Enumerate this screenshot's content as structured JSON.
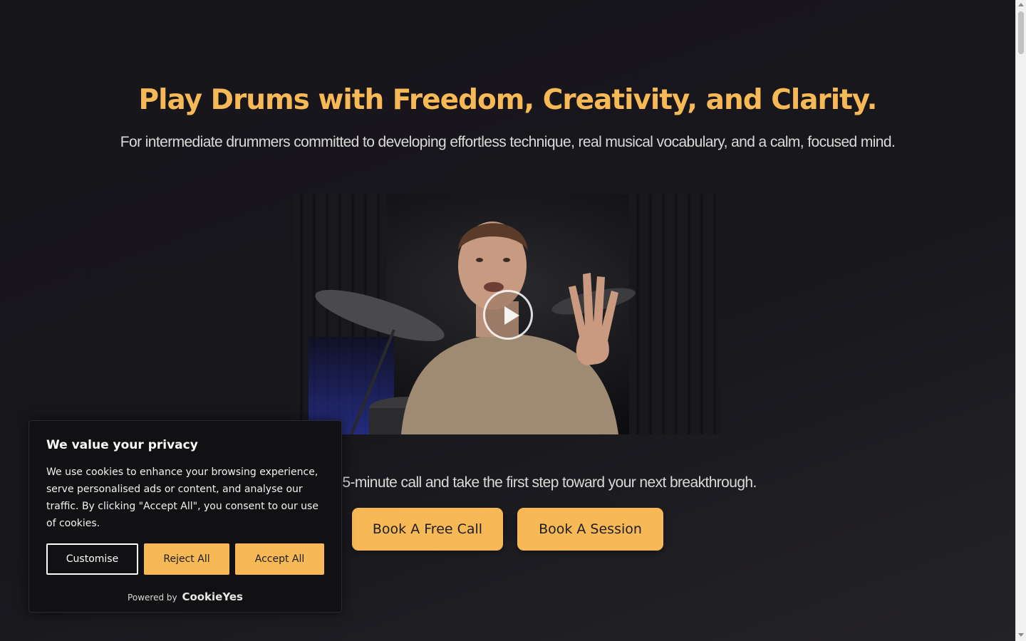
{
  "hero": {
    "title": "Play Drums with Freedom, Creativity, and Clarity.",
    "subtitle": "For intermediate drummers committed to developing effortless technique, real musical vocabulary, and a calm, focused mind."
  },
  "video": {
    "play_icon": "play-icon"
  },
  "cta": {
    "text": "Book a free 15-minute call and take the first step toward your next breakthrough.",
    "free_call_label": "Book A Free Call",
    "session_label": "Book A Session"
  },
  "cookie_banner": {
    "title": "We value your privacy",
    "body": "We use cookies to enhance your browsing experience, serve personalised ads or content, and analyse our traffic. By clicking \"Accept All\", you consent to our use of cookies.",
    "customise_label": "Customise",
    "reject_label": "Reject All",
    "accept_label": "Accept All",
    "powered_by": "Powered by",
    "brand": "CookieYes"
  },
  "colors": {
    "accent": "#f7b955",
    "background": "#18171c",
    "banner_bg": "#111113"
  }
}
